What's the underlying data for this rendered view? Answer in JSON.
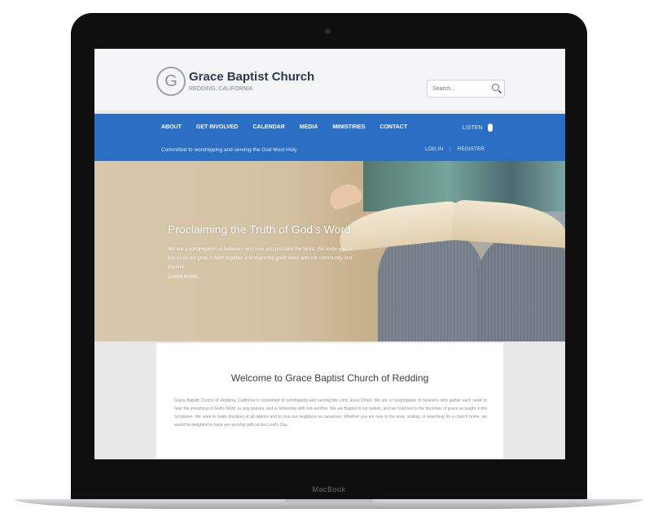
{
  "device": {
    "label": "MacBook"
  },
  "header": {
    "logo_letter": "G",
    "site_name": "Grace Baptist Church",
    "tagline": "REDDING, CALIFORNIA",
    "search_placeholder": "Search..."
  },
  "nav": {
    "items": [
      "About",
      "Get Involved",
      "Calendar",
      "Media",
      "Ministries",
      "Contact"
    ],
    "right_label": "LISTEN",
    "tagline": "Committed to worshipping and serving the God Most Holy.",
    "links": [
      "LOG IN",
      "REGISTER"
    ]
  },
  "hero": {
    "heading": "Proclaiming the Truth of God's Word",
    "text": "We are a congregation of believers who love and proclaim the Word. We invite you to join us as we grow in faith together and share the good news with our community and beyond.",
    "link": "LEARN MORE"
  },
  "content": {
    "title": "Welcome to Grace Baptist Church of Redding",
    "body": "Grace Baptist Church of Redding, California is committed to worshipping and serving the Lord Jesus Christ. We are a congregation of believers who gather each week to hear the preaching of God's Word, to sing praises, and to fellowship with one another. We are Baptist in our beliefs, and we hold fast to the doctrines of grace as taught in the Scriptures. We seek to make disciples of all nations and to love our neighbors as ourselves. Whether you are new to the area, visiting, or searching for a church home, we would be delighted to have you worship with us this Lord's Day."
  },
  "colors": {
    "nav_blue": "#2b6fc4",
    "header_bg": "#f4f5f7",
    "bezel": "#0f0f10"
  }
}
